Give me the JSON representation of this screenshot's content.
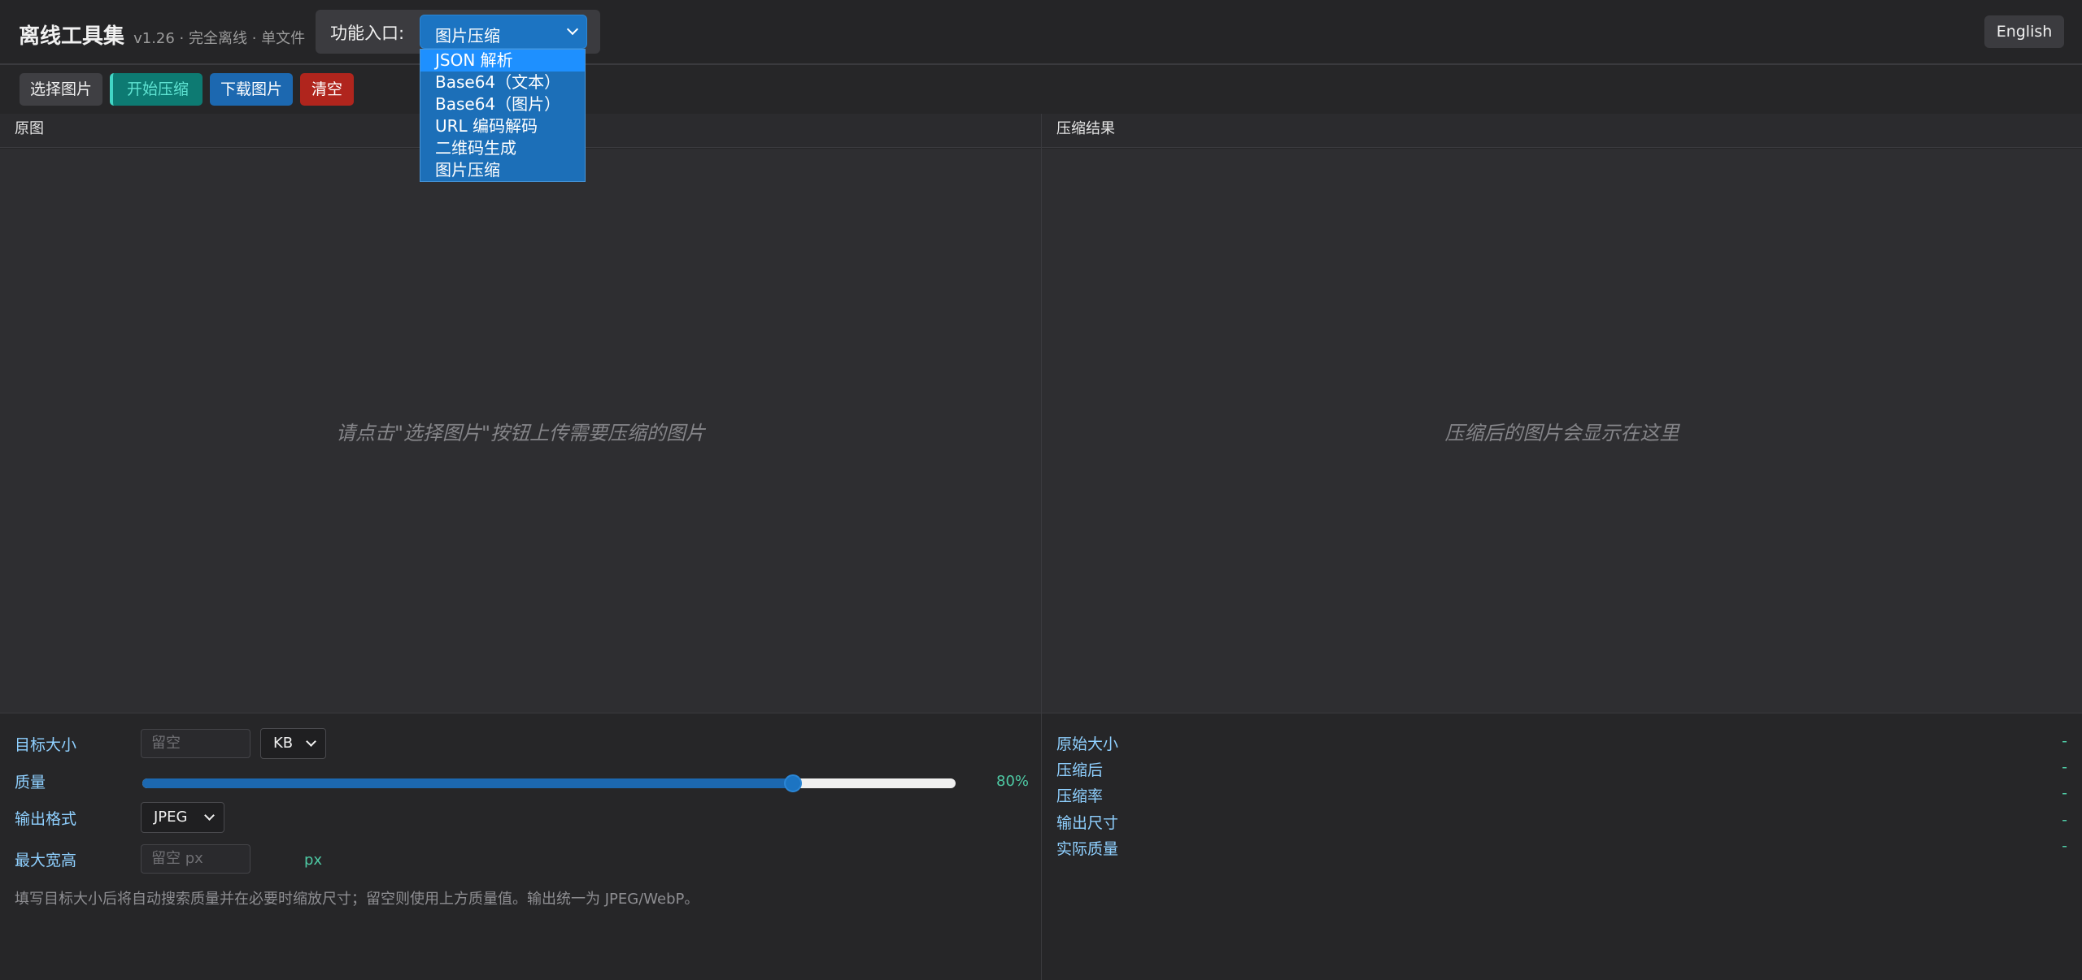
{
  "header": {
    "title": "离线工具集",
    "subtitle": "v1.26 · 完全离线 · 单文件",
    "func_label": "功能入口:",
    "func_selected": "图片压缩",
    "lang_button": "English"
  },
  "dropdown": {
    "options": [
      "JSON 解析",
      "Base64（文本）",
      "Base64（图片）",
      "URL 编码解码",
      "二维码生成",
      "图片压缩"
    ],
    "highlighted": "JSON 解析"
  },
  "toolbar": {
    "select_label": "选择图片",
    "start_label": "开始压缩",
    "download_label": "下载图片",
    "clear_label": "清空"
  },
  "panels": {
    "original_title": "原图",
    "result_title": "压缩结果",
    "original_placeholder": "请点击\"选择图片\"按钮上传需要压缩的图片",
    "result_placeholder": "压缩后的图片会显示在这里"
  },
  "settings": {
    "target_size_label": "目标大小",
    "target_size_placeholder": "留空",
    "target_unit": "KB",
    "quality_label": "质量",
    "quality_value": 80,
    "quality_text": "80%",
    "format_label": "输出格式",
    "format_value": "JPEG",
    "max_dim_label": "最大宽高",
    "max_dim_placeholder": "留空 px",
    "max_dim_unit": "px",
    "hint": "填写目标大小后将自动搜索质量并在必要时缩放尺寸；留空则使用上方质量值。输出统一为 JPEG/WebP。"
  },
  "results": [
    {
      "label": "原始大小",
      "value": "-"
    },
    {
      "label": "压缩后",
      "value": "-"
    },
    {
      "label": "压缩率",
      "value": "-"
    },
    {
      "label": "输出尺寸",
      "value": "-"
    },
    {
      "label": "实际质量",
      "value": "-"
    }
  ],
  "colors": {
    "accent": "#1c74c2",
    "danger": "#b0251d",
    "teal": "#0d7a72",
    "label": "#8fd0ff",
    "value": "#4ec9a4"
  }
}
